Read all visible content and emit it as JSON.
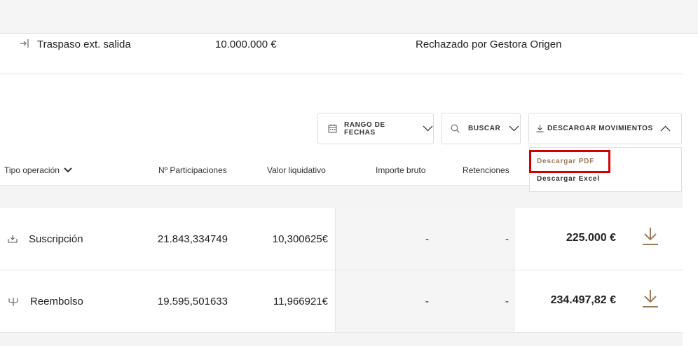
{
  "previous_row": {
    "icon": "transfer-out-icon",
    "type": "Traspaso ext. salida",
    "amount": "10.000.000 €",
    "status": "Rechazado por Gestora Origen"
  },
  "controls": {
    "date_range_label": "RANGO DE FECHAS",
    "search_label": "BUSCAR",
    "download_label": "DESCARGAR MOVIMIENTOS"
  },
  "download_menu": {
    "items": [
      {
        "label": "Descargar PDF",
        "color": "#9a7b57"
      },
      {
        "label": "Descargar Excel",
        "color": "#333333"
      }
    ]
  },
  "table": {
    "headers": {
      "tipo": "Tipo operación",
      "participaciones": "Nº Participaciones",
      "valor": "Valor liquidativo",
      "importe_bruto": "Importe bruto",
      "retenciones": "Retenciones"
    },
    "rows": [
      {
        "icon": "download-icon",
        "tipo": "Suscripción",
        "participaciones": "21.843,334749",
        "valor": "10,300625€",
        "importe_bruto": "-",
        "retenciones": "-",
        "importe": "225.000 €"
      },
      {
        "icon": "withdraw-icon",
        "tipo": "Reembolso",
        "participaciones": "19.595,501633",
        "valor": "11,966921€",
        "importe_bruto": "-",
        "retenciones": "-",
        "importe": "234.497,82 €"
      }
    ]
  },
  "colors": {
    "accent": "#9a7b57",
    "highlight": "#d40000"
  }
}
